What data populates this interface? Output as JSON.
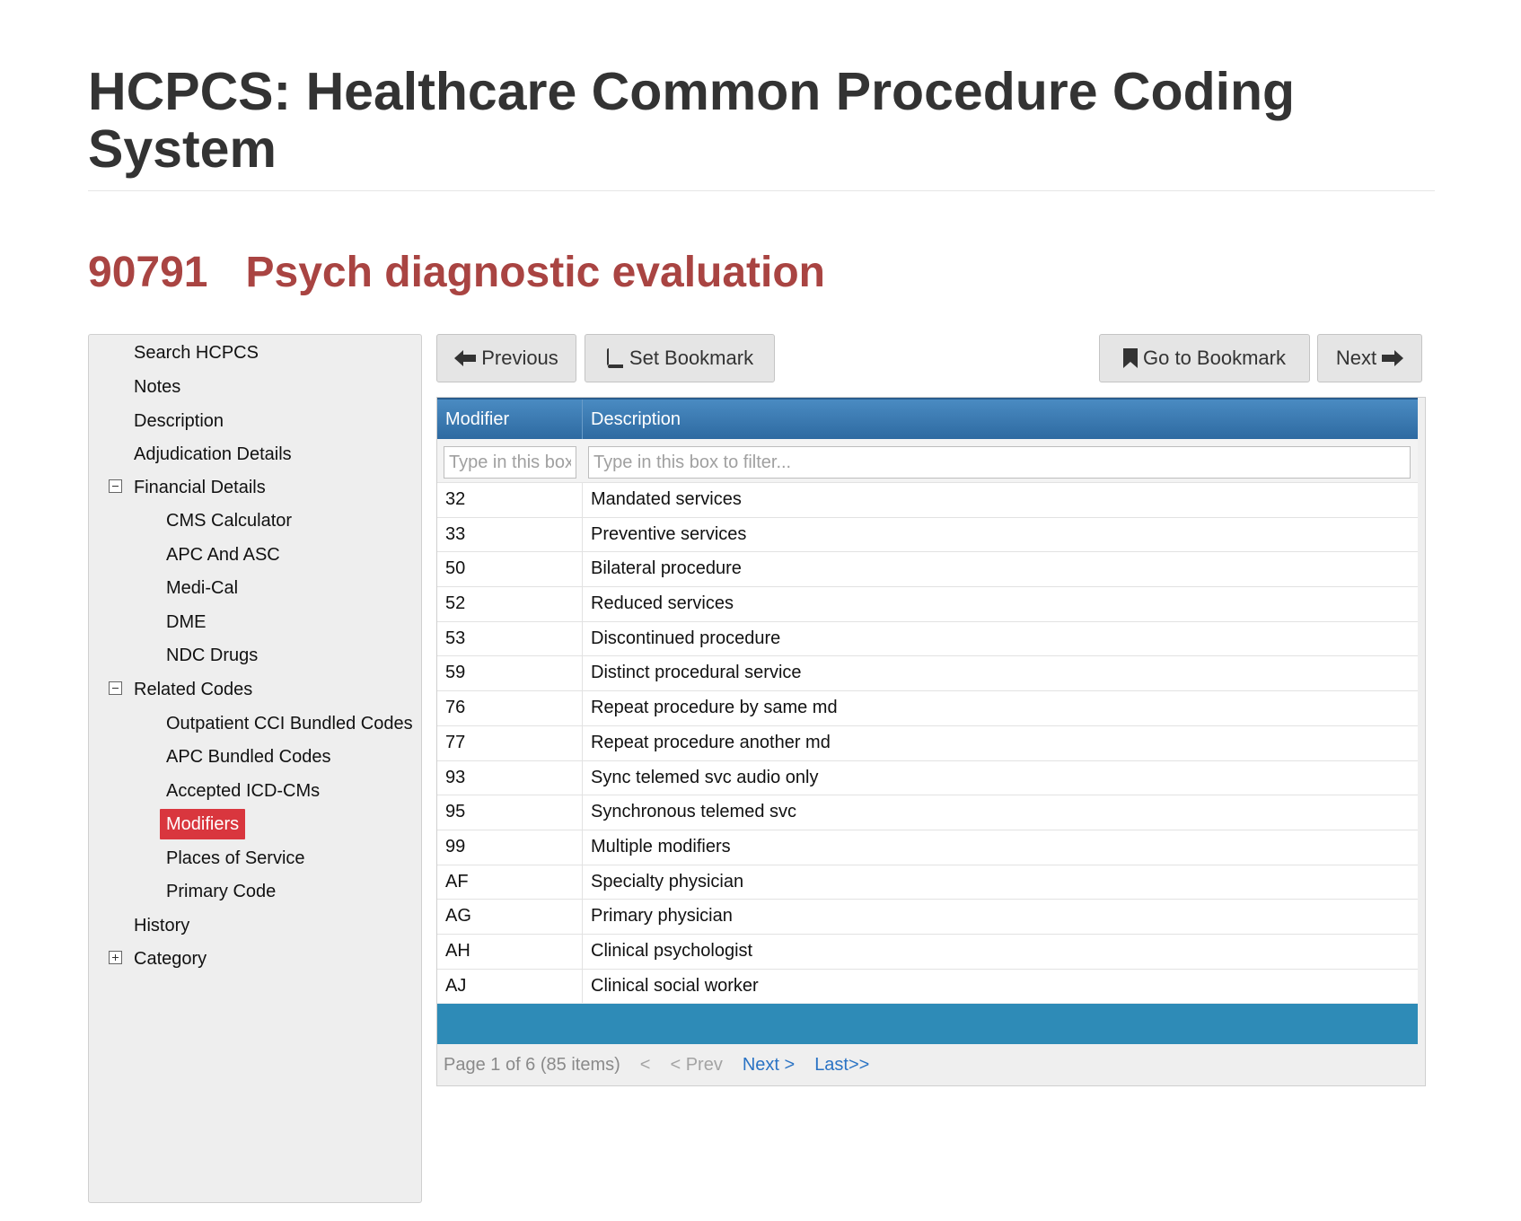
{
  "page": {
    "title": "HCPCS: Healthcare Common Procedure Coding System",
    "code": "90791",
    "code_description": "Psych diagnostic evaluation"
  },
  "sidebar": {
    "items": [
      {
        "label": "Search HCPCS"
      },
      {
        "label": "Notes"
      },
      {
        "label": "Description"
      },
      {
        "label": "Adjudication Details"
      },
      {
        "label": "Financial Details",
        "toggle": "collapse"
      },
      {
        "label": "CMS Calculator"
      },
      {
        "label": "APC And ASC"
      },
      {
        "label": "Medi-Cal"
      },
      {
        "label": "DME"
      },
      {
        "label": "NDC Drugs"
      },
      {
        "label": "Related Codes",
        "toggle": "collapse"
      },
      {
        "label": "Outpatient CCI Bundled Codes"
      },
      {
        "label": "APC Bundled Codes"
      },
      {
        "label": "Accepted ICD-CMs"
      },
      {
        "label": "Modifiers",
        "active": true
      },
      {
        "label": "Places of Service"
      },
      {
        "label": "Primary Code"
      },
      {
        "label": "History"
      },
      {
        "label": "Category",
        "toggle": "expand"
      }
    ]
  },
  "toolbar": {
    "previous_label": "Previous",
    "set_bookmark_label": "Set Bookmark",
    "go_to_bookmark_label": "Go to Bookmark",
    "next_label": "Next"
  },
  "grid": {
    "columns": [
      "Modifier",
      "Description"
    ],
    "filter_placeholders": {
      "modifier": "Type in this box",
      "description": "Type in this box to filter..."
    },
    "rows": [
      {
        "modifier": "32",
        "description": "Mandated services"
      },
      {
        "modifier": "33",
        "description": "Preventive services"
      },
      {
        "modifier": "50",
        "description": "Bilateral procedure"
      },
      {
        "modifier": "52",
        "description": "Reduced services"
      },
      {
        "modifier": "53",
        "description": "Discontinued procedure"
      },
      {
        "modifier": "59",
        "description": "Distinct procedural service"
      },
      {
        "modifier": "76",
        "description": "Repeat procedure by same md"
      },
      {
        "modifier": "77",
        "description": "Repeat procedure another md"
      },
      {
        "modifier": "93",
        "description": "Sync telemed svc audio only"
      },
      {
        "modifier": "95",
        "description": "Synchronous telemed svc"
      },
      {
        "modifier": "99",
        "description": "Multiple modifiers"
      },
      {
        "modifier": "AF",
        "description": "Specialty physician"
      },
      {
        "modifier": "AG",
        "description": "Primary physician"
      },
      {
        "modifier": "AH",
        "description": "Clinical psychologist"
      },
      {
        "modifier": "AJ",
        "description": "Clinical social worker"
      }
    ],
    "pager": {
      "info": "Page 1 of 6 (85 items)",
      "first": "<",
      "prev": "< Prev",
      "next": "Next >",
      "last": "Last>>"
    }
  },
  "colors": {
    "heading_red": "#a94442",
    "active_item": "#d9363e",
    "grid_header": "#2e6aa1",
    "footer_bar": "#2e8bb7",
    "link": "#2a73c4"
  }
}
